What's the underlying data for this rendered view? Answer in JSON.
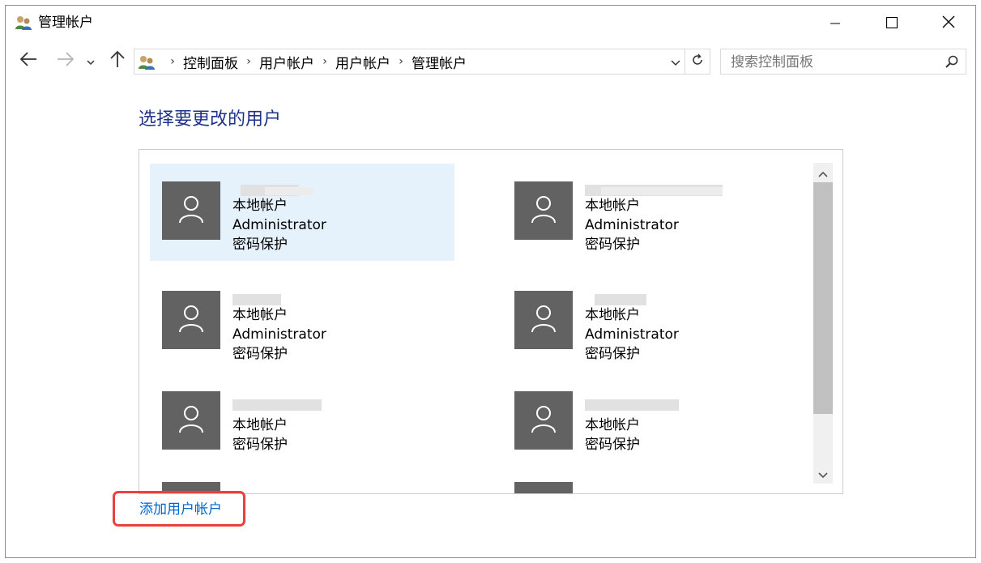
{
  "window": {
    "title": "管理帐户"
  },
  "nav": {
    "breadcrumbs": [
      "控制面板",
      "用户帐户",
      "用户帐户",
      "管理帐户"
    ]
  },
  "search": {
    "placeholder": "搜索控制面板"
  },
  "main": {
    "heading": "选择要更改的用户",
    "users": [
      {
        "type": "本地帐户",
        "role": "Administrator",
        "status": "密码保护",
        "selected": true
      },
      {
        "type": "本地帐户",
        "role": "Administrator",
        "status": "密码保护",
        "selected": false
      },
      {
        "type": "本地帐户",
        "role": "Administrator",
        "status": "密码保护",
        "selected": false
      },
      {
        "type": "本地帐户",
        "role": "Administrator",
        "status": "密码保护",
        "selected": false
      },
      {
        "type": "本地帐户",
        "role": "",
        "status": "密码保护",
        "selected": false
      },
      {
        "type": "本地帐户",
        "role": "",
        "status": "密码保护",
        "selected": false
      }
    ],
    "add_user_link": "添加用户帐户"
  },
  "colors": {
    "heading": "#1e3287",
    "link": "#0066cc",
    "selected_tile": "#e5f1fb",
    "avatar_bg": "#626262",
    "highlight_box": "#e8413f"
  }
}
